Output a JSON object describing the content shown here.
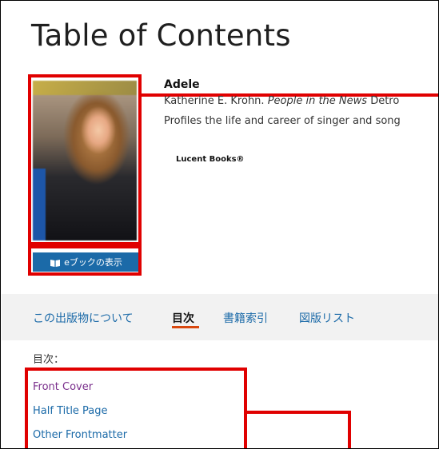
{
  "page": {
    "title": "Table of Contents"
  },
  "book": {
    "title": "Adele",
    "author_prefix": "Katherine E. Krohn. ",
    "series": "People in the News",
    "author_suffix": " Detro",
    "description": "Profiles the life and career of singer and song",
    "publisher": "Lucent Books®",
    "ebook_button_label": "eブックの表示"
  },
  "tabs": [
    {
      "label": "この出版物について",
      "active": false
    },
    {
      "label": "目次",
      "active": true
    },
    {
      "label": "書籍索引",
      "active": false
    },
    {
      "label": "図版リスト",
      "active": false
    }
  ],
  "toc": {
    "heading": "目次：",
    "items": [
      {
        "label": "Front Cover",
        "visited": true
      },
      {
        "label": "Half Title Page",
        "visited": false
      },
      {
        "label": "Other Frontmatter",
        "visited": false
      }
    ]
  },
  "colors": {
    "annotation_red": "#e00000",
    "link_blue": "#1b6aa8",
    "visited_purple": "#7a2f8c",
    "active_tab_underline": "#d9480f"
  },
  "icons": {
    "ebook_button": "book-icon"
  }
}
